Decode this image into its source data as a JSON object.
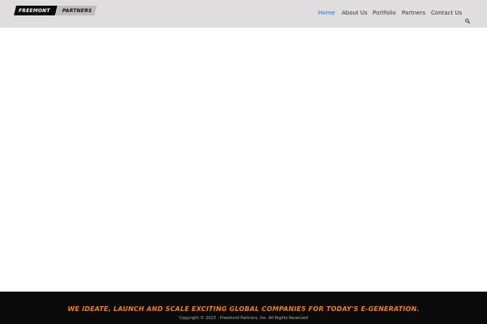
{
  "header": {
    "logo": {
      "left_text": "FREEMONT",
      "right_text": "PARTNERS"
    },
    "nav": [
      {
        "label": "Home",
        "active": true
      },
      {
        "label": "About Us",
        "active": false
      },
      {
        "label": "Portfolio",
        "active": false
      },
      {
        "label": "Partners",
        "active": false
      },
      {
        "label": "Contact Us",
        "active": false
      }
    ],
    "search_icon": "search-icon"
  },
  "footer": {
    "tagline": "WE IDEATE, LAUNCH AND SCALE EXCITING GLOBAL COMPANIES FOR TODAY'S E-GENERATION.",
    "copyright": "Copyright © 2023 - Freemont Partners, Inc. All Rights Reserved"
  },
  "colors": {
    "header_bg": "#dfdddd",
    "nav_active": "#2a6fc9",
    "footer_bg": "#0a0a0a",
    "tagline": "#e8822a"
  }
}
